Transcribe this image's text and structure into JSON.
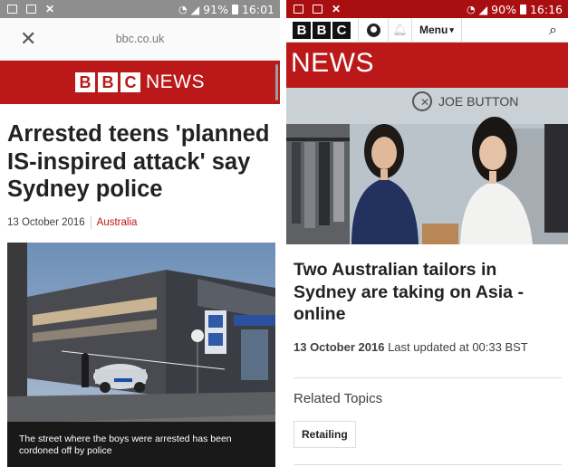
{
  "left": {
    "status": {
      "battery": "91%",
      "time": "16:01"
    },
    "browser": {
      "url": "bbc.co.uk",
      "close_icon": "close-icon"
    },
    "header": {
      "logo_letters": [
        "B",
        "B",
        "C"
      ],
      "logo_word": "NEWS"
    },
    "article": {
      "headline": "Arrested teens 'planned IS-inspired attack' say Sydney police",
      "date": "13 October 2016",
      "category": "Australia",
      "caption": "The street where the boys were arrested has been cordoned off by police"
    },
    "colors": {
      "brand_red": "#bb1919",
      "status_bar": "#8e8e8e"
    }
  },
  "right": {
    "status": {
      "battery": "90%",
      "time": "16:16"
    },
    "nav": {
      "logo_letters": [
        "B",
        "B",
        "C"
      ],
      "menu_label": "Menu",
      "icons": [
        "account-icon",
        "notification-bell-icon",
        "search-icon"
      ]
    },
    "banner": "NEWS",
    "photo": {
      "sign_text": "JOE BUTTON"
    },
    "article": {
      "headline": "Two Australian tailors in Sydney are taking on Asia - online",
      "date": "13 October 2016",
      "updated": "Last updated at 00:33 BST"
    },
    "related": {
      "heading": "Related Topics",
      "tags": [
        "Retailing"
      ]
    },
    "colors": {
      "brand_red": "#bb1919",
      "status_bar": "#a90e10"
    }
  }
}
